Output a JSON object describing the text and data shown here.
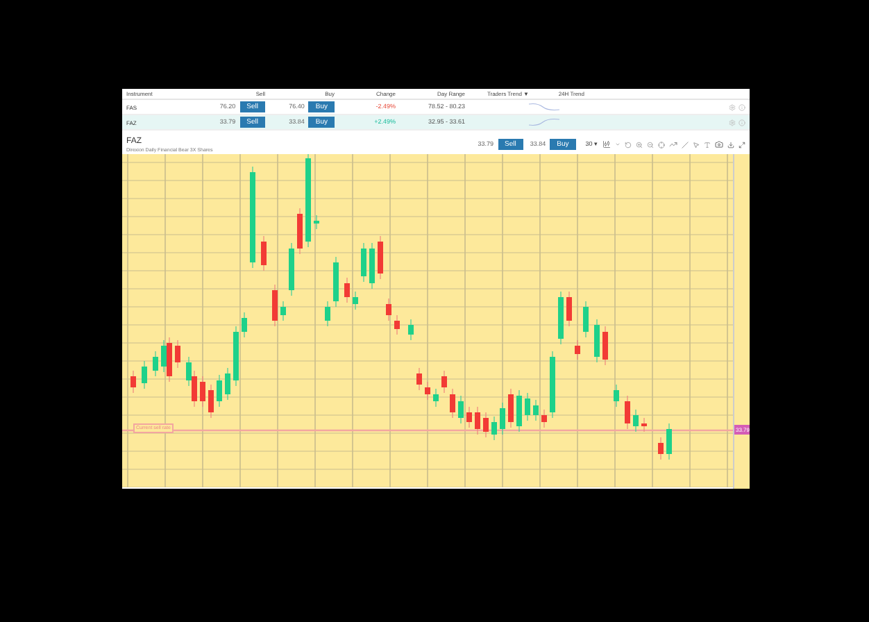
{
  "table": {
    "columns": [
      "Instrument",
      "Sell",
      "Buy",
      "Change",
      "Day Range",
      "Traders Trend ▼",
      "24H Trend"
    ],
    "rows": [
      {
        "instrument": "FAS",
        "sell": "76.20",
        "sell_button": "Sell",
        "buy": "76.40",
        "buy_button": "Buy",
        "change": "-2.49%",
        "kind": "down",
        "day_range": "78.52 - 80.23",
        "selected": false
      },
      {
        "instrument": "FAZ",
        "sell": "33.79",
        "sell_button": "Sell",
        "buy": "33.84",
        "buy_button": "Buy",
        "change": "+2.49%",
        "kind": "up",
        "day_range": "32.95 - 33.61",
        "selected": true
      }
    ]
  },
  "chart_panel": {
    "symbol": "FAZ",
    "name": "Direxion Daily Financial Bear 3X Shares",
    "sell": "33.79",
    "sell_button": "Sell",
    "buy": "33.84",
    "buy_button": "Buy",
    "interval": "30 ▾",
    "current_rate_label": "Current sell rate",
    "price_tag": "33.79"
  }
}
